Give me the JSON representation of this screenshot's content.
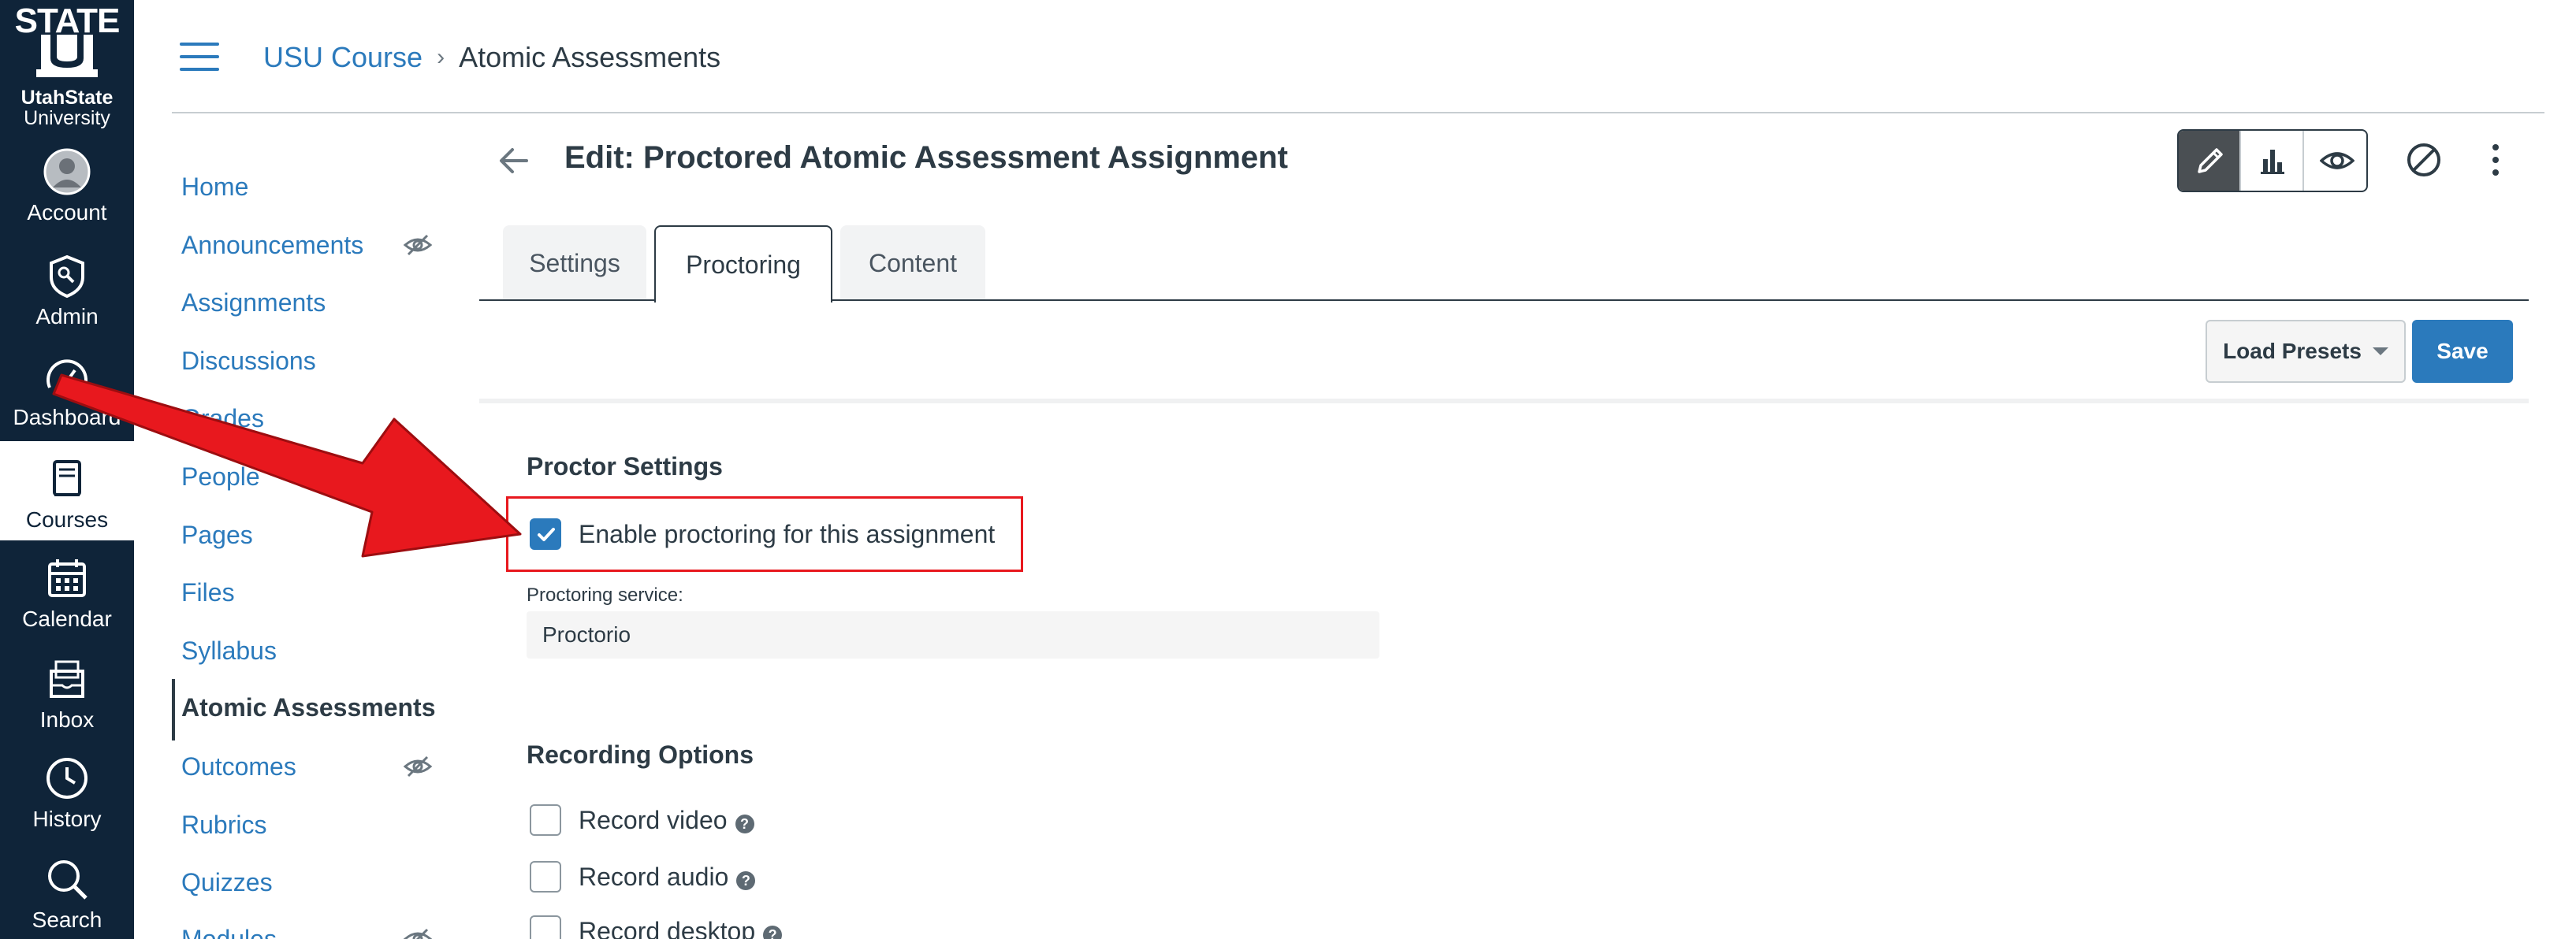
{
  "brand": {
    "logo_text": "STATE",
    "logo_letter": "U",
    "institution_line1": "UtahState",
    "institution_line2": "University"
  },
  "global_nav": [
    {
      "label": "Account",
      "icon": "account-avatar-icon"
    },
    {
      "label": "Admin",
      "icon": "admin-shield-icon"
    },
    {
      "label": "Dashboard",
      "icon": "dashboard-gauge-icon"
    },
    {
      "label": "Courses",
      "icon": "courses-book-icon",
      "active": true
    },
    {
      "label": "Calendar",
      "icon": "calendar-icon"
    },
    {
      "label": "Inbox",
      "icon": "inbox-icon"
    },
    {
      "label": "History",
      "icon": "history-clock-icon"
    },
    {
      "label": "Search",
      "icon": "search-icon"
    }
  ],
  "breadcrumb": {
    "course": "USU Course",
    "separator": "›",
    "current": "Atomic Assessments"
  },
  "course_nav": [
    {
      "label": "Home"
    },
    {
      "label": "Announcements",
      "hidden_from_students": true
    },
    {
      "label": "Assignments"
    },
    {
      "label": "Discussions"
    },
    {
      "label": "Grades"
    },
    {
      "label": "People"
    },
    {
      "label": "Pages"
    },
    {
      "label": "Files"
    },
    {
      "label": "Syllabus"
    },
    {
      "label": "Atomic Assessments",
      "active": true
    },
    {
      "label": "Outcomes",
      "hidden_from_students": true
    },
    {
      "label": "Rubrics"
    },
    {
      "label": "Quizzes"
    },
    {
      "label": "Modules",
      "hidden_from_students": true
    }
  ],
  "page": {
    "title": "Edit: Proctored Atomic Assessment Assignment",
    "view_modes": [
      "edit-pencil-icon",
      "reports-bar-chart-icon",
      "preview-eye-icon"
    ],
    "active_view_mode": "edit-pencil-icon"
  },
  "tabs": [
    {
      "label": "Settings",
      "active": false
    },
    {
      "label": "Proctoring",
      "active": true
    },
    {
      "label": "Content",
      "active": false
    }
  ],
  "toolbar": {
    "load_presets_label": "Load Presets",
    "save_label": "Save"
  },
  "proctor_settings": {
    "heading": "Proctor Settings",
    "enable_label": "Enable proctoring for this assignment",
    "enable_checked": true,
    "service_label": "Proctoring service:",
    "service_value": "Proctorio"
  },
  "recording_options": {
    "heading": "Recording Options",
    "options": [
      {
        "label": "Record video",
        "checked": false
      },
      {
        "label": "Record audio",
        "checked": false
      },
      {
        "label": "Record desktop",
        "checked": false
      }
    ],
    "help_glyph": "?"
  },
  "colors": {
    "nav_background": "#0f2439",
    "link_blue": "#2b7abc",
    "text_dark": "#2d3b45",
    "annotation_red": "#e8181e"
  }
}
